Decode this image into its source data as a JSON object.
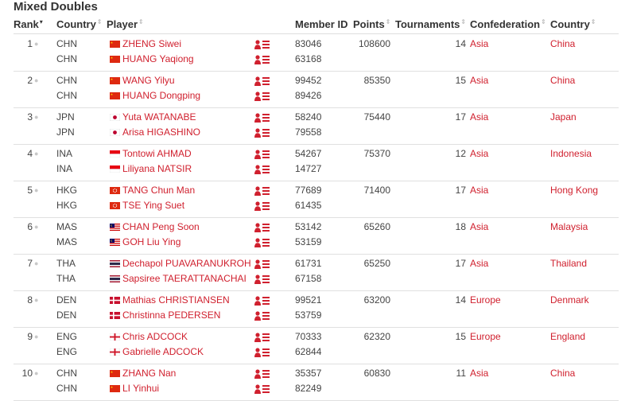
{
  "table_title": "Mixed Doubles",
  "columns": {
    "rank": "Rank",
    "country": "Country",
    "player": "Player",
    "member_id": "Member ID",
    "points": "Points",
    "tournaments": "Tournaments",
    "confederation": "Confederation",
    "country_name": "Country"
  },
  "rows": [
    {
      "rank": "1",
      "points": "108600",
      "tournaments": "14",
      "confederation": "Asia",
      "country_name": "China",
      "p1": {
        "code": "CHN",
        "name": "ZHENG Siwei",
        "id": "83046"
      },
      "p2": {
        "code": "CHN",
        "name": "HUANG Yaqiong",
        "id": "63168"
      }
    },
    {
      "rank": "2",
      "points": "85350",
      "tournaments": "15",
      "confederation": "Asia",
      "country_name": "China",
      "p1": {
        "code": "CHN",
        "name": "WANG Yilyu",
        "id": "99452"
      },
      "p2": {
        "code": "CHN",
        "name": "HUANG Dongping",
        "id": "89426"
      }
    },
    {
      "rank": "3",
      "points": "75440",
      "tournaments": "17",
      "confederation": "Asia",
      "country_name": "Japan",
      "p1": {
        "code": "JPN",
        "name": "Yuta WATANABE",
        "id": "58240"
      },
      "p2": {
        "code": "JPN",
        "name": "Arisa HIGASHINO",
        "id": "79558"
      }
    },
    {
      "rank": "4",
      "points": "75370",
      "tournaments": "12",
      "confederation": "Asia",
      "country_name": "Indonesia",
      "p1": {
        "code": "INA",
        "name": "Tontowi AHMAD",
        "id": "54267"
      },
      "p2": {
        "code": "INA",
        "name": "Liliyana NATSIR",
        "id": "14727"
      }
    },
    {
      "rank": "5",
      "points": "71400",
      "tournaments": "17",
      "confederation": "Asia",
      "country_name": "Hong Kong",
      "p1": {
        "code": "HKG",
        "name": "TANG Chun Man",
        "id": "77689"
      },
      "p2": {
        "code": "HKG",
        "name": "TSE Ying Suet",
        "id": "61435"
      }
    },
    {
      "rank": "6",
      "points": "65260",
      "tournaments": "18",
      "confederation": "Asia",
      "country_name": "Malaysia",
      "p1": {
        "code": "MAS",
        "name": "CHAN Peng Soon",
        "id": "53142"
      },
      "p2": {
        "code": "MAS",
        "name": "GOH Liu Ying",
        "id": "53159"
      }
    },
    {
      "rank": "7",
      "points": "65250",
      "tournaments": "17",
      "confederation": "Asia",
      "country_name": "Thailand",
      "p1": {
        "code": "THA",
        "name": "Dechapol PUAVARANUKROH",
        "id": "61731"
      },
      "p2": {
        "code": "THA",
        "name": "Sapsiree TAERATTANACHAI",
        "id": "67158"
      }
    },
    {
      "rank": "8",
      "points": "63200",
      "tournaments": "14",
      "confederation": "Europe",
      "country_name": "Denmark",
      "p1": {
        "code": "DEN",
        "name": "Mathias CHRISTIANSEN",
        "id": "99521"
      },
      "p2": {
        "code": "DEN",
        "name": "Christinna PEDERSEN",
        "id": "53759"
      }
    },
    {
      "rank": "9",
      "points": "62320",
      "tournaments": "15",
      "confederation": "Europe",
      "country_name": "England",
      "p1": {
        "code": "ENG",
        "name": "Chris ADCOCK",
        "id": "70333"
      },
      "p2": {
        "code": "ENG",
        "name": "Gabrielle ADCOCK",
        "id": "62844"
      }
    },
    {
      "rank": "10",
      "points": "60830",
      "tournaments": "11",
      "confederation": "Asia",
      "country_name": "China",
      "p1": {
        "code": "CHN",
        "name": "ZHANG Nan",
        "id": "35357"
      },
      "p2": {
        "code": "CHN",
        "name": "LI Yinhui",
        "id": "82249"
      }
    }
  ],
  "colors": {
    "link": "#d0202e",
    "text": "#444444",
    "border": "#e0e0e0"
  },
  "icons": {
    "profile": "user-list-icon",
    "rank_change": "rank-dot-icon",
    "sort": "sort-arrows-icon"
  }
}
